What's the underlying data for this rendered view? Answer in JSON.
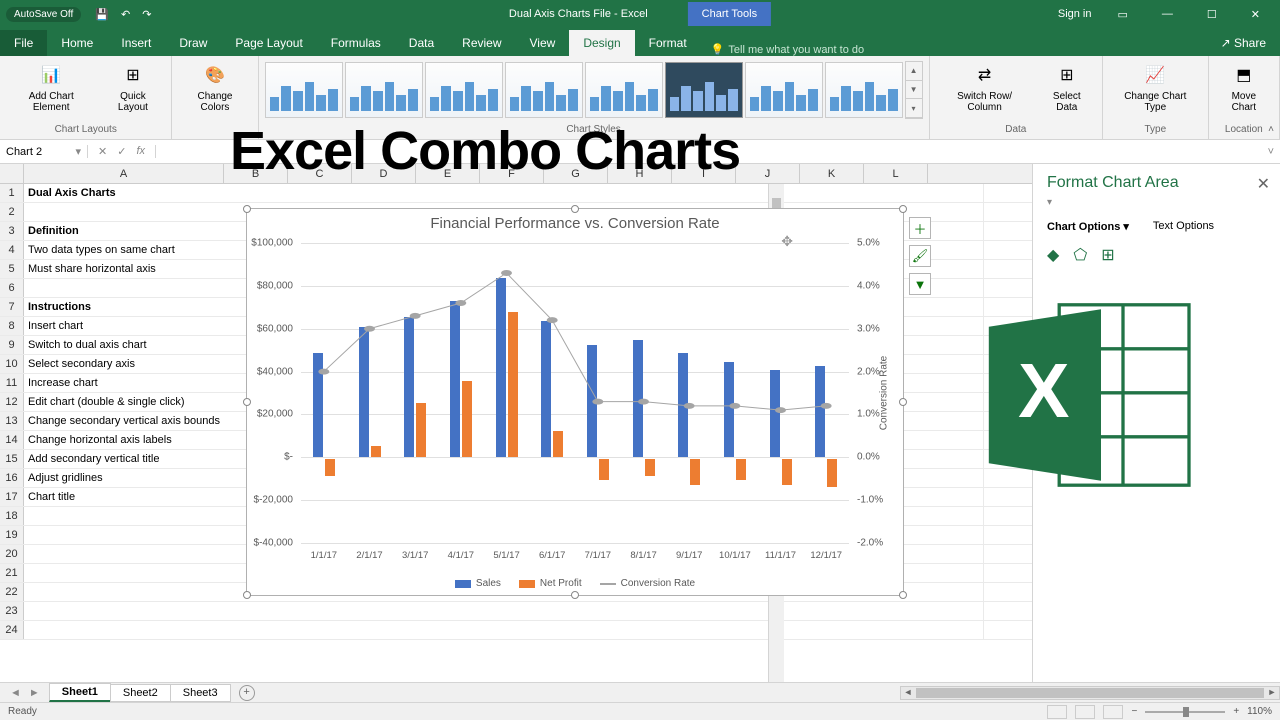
{
  "title_bar": {
    "autosave": "AutoSave  Off",
    "filename": "Dual Axis Charts File  -  Excel",
    "chart_tools": "Chart Tools",
    "sign_in": "Sign in"
  },
  "ribbon_tabs": [
    "File",
    "Home",
    "Insert",
    "Draw",
    "Page Layout",
    "Formulas",
    "Data",
    "Review",
    "View",
    "Design",
    "Format"
  ],
  "tell_me": "Tell me what you want to do",
  "share": "Share",
  "ribbon": {
    "layouts_label": "Chart Layouts",
    "add_element": "Add Chart Element",
    "quick_layout": "Quick Layout",
    "change_colors": "Change Colors",
    "styles_label": "Chart Styles",
    "switch": "Switch Row/ Column",
    "select_data": "Select Data",
    "data_label": "Data",
    "change_type": "Change Chart Type",
    "type_label": "Type",
    "move_chart": "Move Chart",
    "location_label": "Location"
  },
  "name_box": "Chart 2",
  "overlay_title": "Excel Combo Charts",
  "columns": [
    "A",
    "B",
    "C",
    "D",
    "E",
    "F",
    "G",
    "H",
    "I",
    "J",
    "K",
    "L"
  ],
  "rows": [
    {
      "n": 1,
      "a": "Dual Axis Charts",
      "bold": true
    },
    {
      "n": 2,
      "a": ""
    },
    {
      "n": 3,
      "a": "Definition",
      "bold": true
    },
    {
      "n": 4,
      "a": "Two data types on same chart"
    },
    {
      "n": 5,
      "a": "Must share horizontal axis"
    },
    {
      "n": 6,
      "a": ""
    },
    {
      "n": 7,
      "a": "Instructions",
      "bold": true
    },
    {
      "n": 8,
      "a": "Insert chart"
    },
    {
      "n": 9,
      "a": "Switch to dual axis chart"
    },
    {
      "n": 10,
      "a": "Select secondary axis"
    },
    {
      "n": 11,
      "a": "Increase chart"
    },
    {
      "n": 12,
      "a": "Edit chart (double & single click)"
    },
    {
      "n": 13,
      "a": "Change secondary vertical axis bounds"
    },
    {
      "n": 14,
      "a": "Change horizontal axis labels"
    },
    {
      "n": 15,
      "a": "Add secondary vertical title"
    },
    {
      "n": 16,
      "a": "Adjust gridlines"
    },
    {
      "n": 17,
      "a": "Chart title"
    },
    {
      "n": 18,
      "a": ""
    },
    {
      "n": 19,
      "a": ""
    },
    {
      "n": 20,
      "a": ""
    },
    {
      "n": 21,
      "a": ""
    },
    {
      "n": 22,
      "a": ""
    },
    {
      "n": 23,
      "a": ""
    },
    {
      "n": 24,
      "a": ""
    }
  ],
  "chart_data": {
    "type": "combo",
    "title": "Financial Performance vs. Conversion Rate",
    "categories": [
      "1/1/17",
      "2/1/17",
      "3/1/17",
      "4/1/17",
      "5/1/17",
      "6/1/17",
      "7/1/17",
      "8/1/17",
      "9/1/17",
      "10/1/17",
      "11/1/17",
      "12/1/17"
    ],
    "series": [
      {
        "name": "Sales",
        "type": "bar",
        "axis": "left",
        "color": "#4472c4",
        "values": [
          48000,
          60000,
          65000,
          72000,
          83000,
          63000,
          52000,
          54000,
          48000,
          44000,
          40000,
          42000
        ]
      },
      {
        "name": "Net Profit",
        "type": "bar",
        "axis": "left",
        "color": "#ed7d31",
        "values": [
          -8000,
          5000,
          25000,
          35000,
          67000,
          12000,
          -10000,
          -8000,
          -12000,
          -10000,
          -12000,
          -13000
        ]
      },
      {
        "name": "Conversion Rate",
        "type": "line",
        "axis": "right",
        "color": "#a5a5a5",
        "values": [
          2.0,
          3.0,
          3.3,
          3.6,
          4.3,
          3.2,
          1.3,
          1.3,
          1.2,
          1.2,
          1.1,
          1.2
        ]
      }
    ],
    "y_left": {
      "min": -40000,
      "max": 100000,
      "ticks": [
        "$100,000",
        "$80,000",
        "$60,000",
        "$40,000",
        "$20,000",
        "$-",
        "$-20,000",
        "$-40,000"
      ]
    },
    "y_right": {
      "min": -2.0,
      "max": 5.0,
      "ticks": [
        "5.0%",
        "4.0%",
        "3.0%",
        "2.0%",
        "1.0%",
        "0.0%",
        "-1.0%",
        "-2.0%"
      ],
      "title": "Conversion Rate"
    },
    "legend": [
      "Sales",
      "Net Profit",
      "Conversion Rate"
    ]
  },
  "format_pane": {
    "title": "Format Chart Area",
    "chart_options": "Chart Options",
    "text_options": "Text Options"
  },
  "sheet_tabs": [
    "Sheet1",
    "Sheet2",
    "Sheet3"
  ],
  "status": {
    "ready": "Ready",
    "zoom": "110%"
  }
}
